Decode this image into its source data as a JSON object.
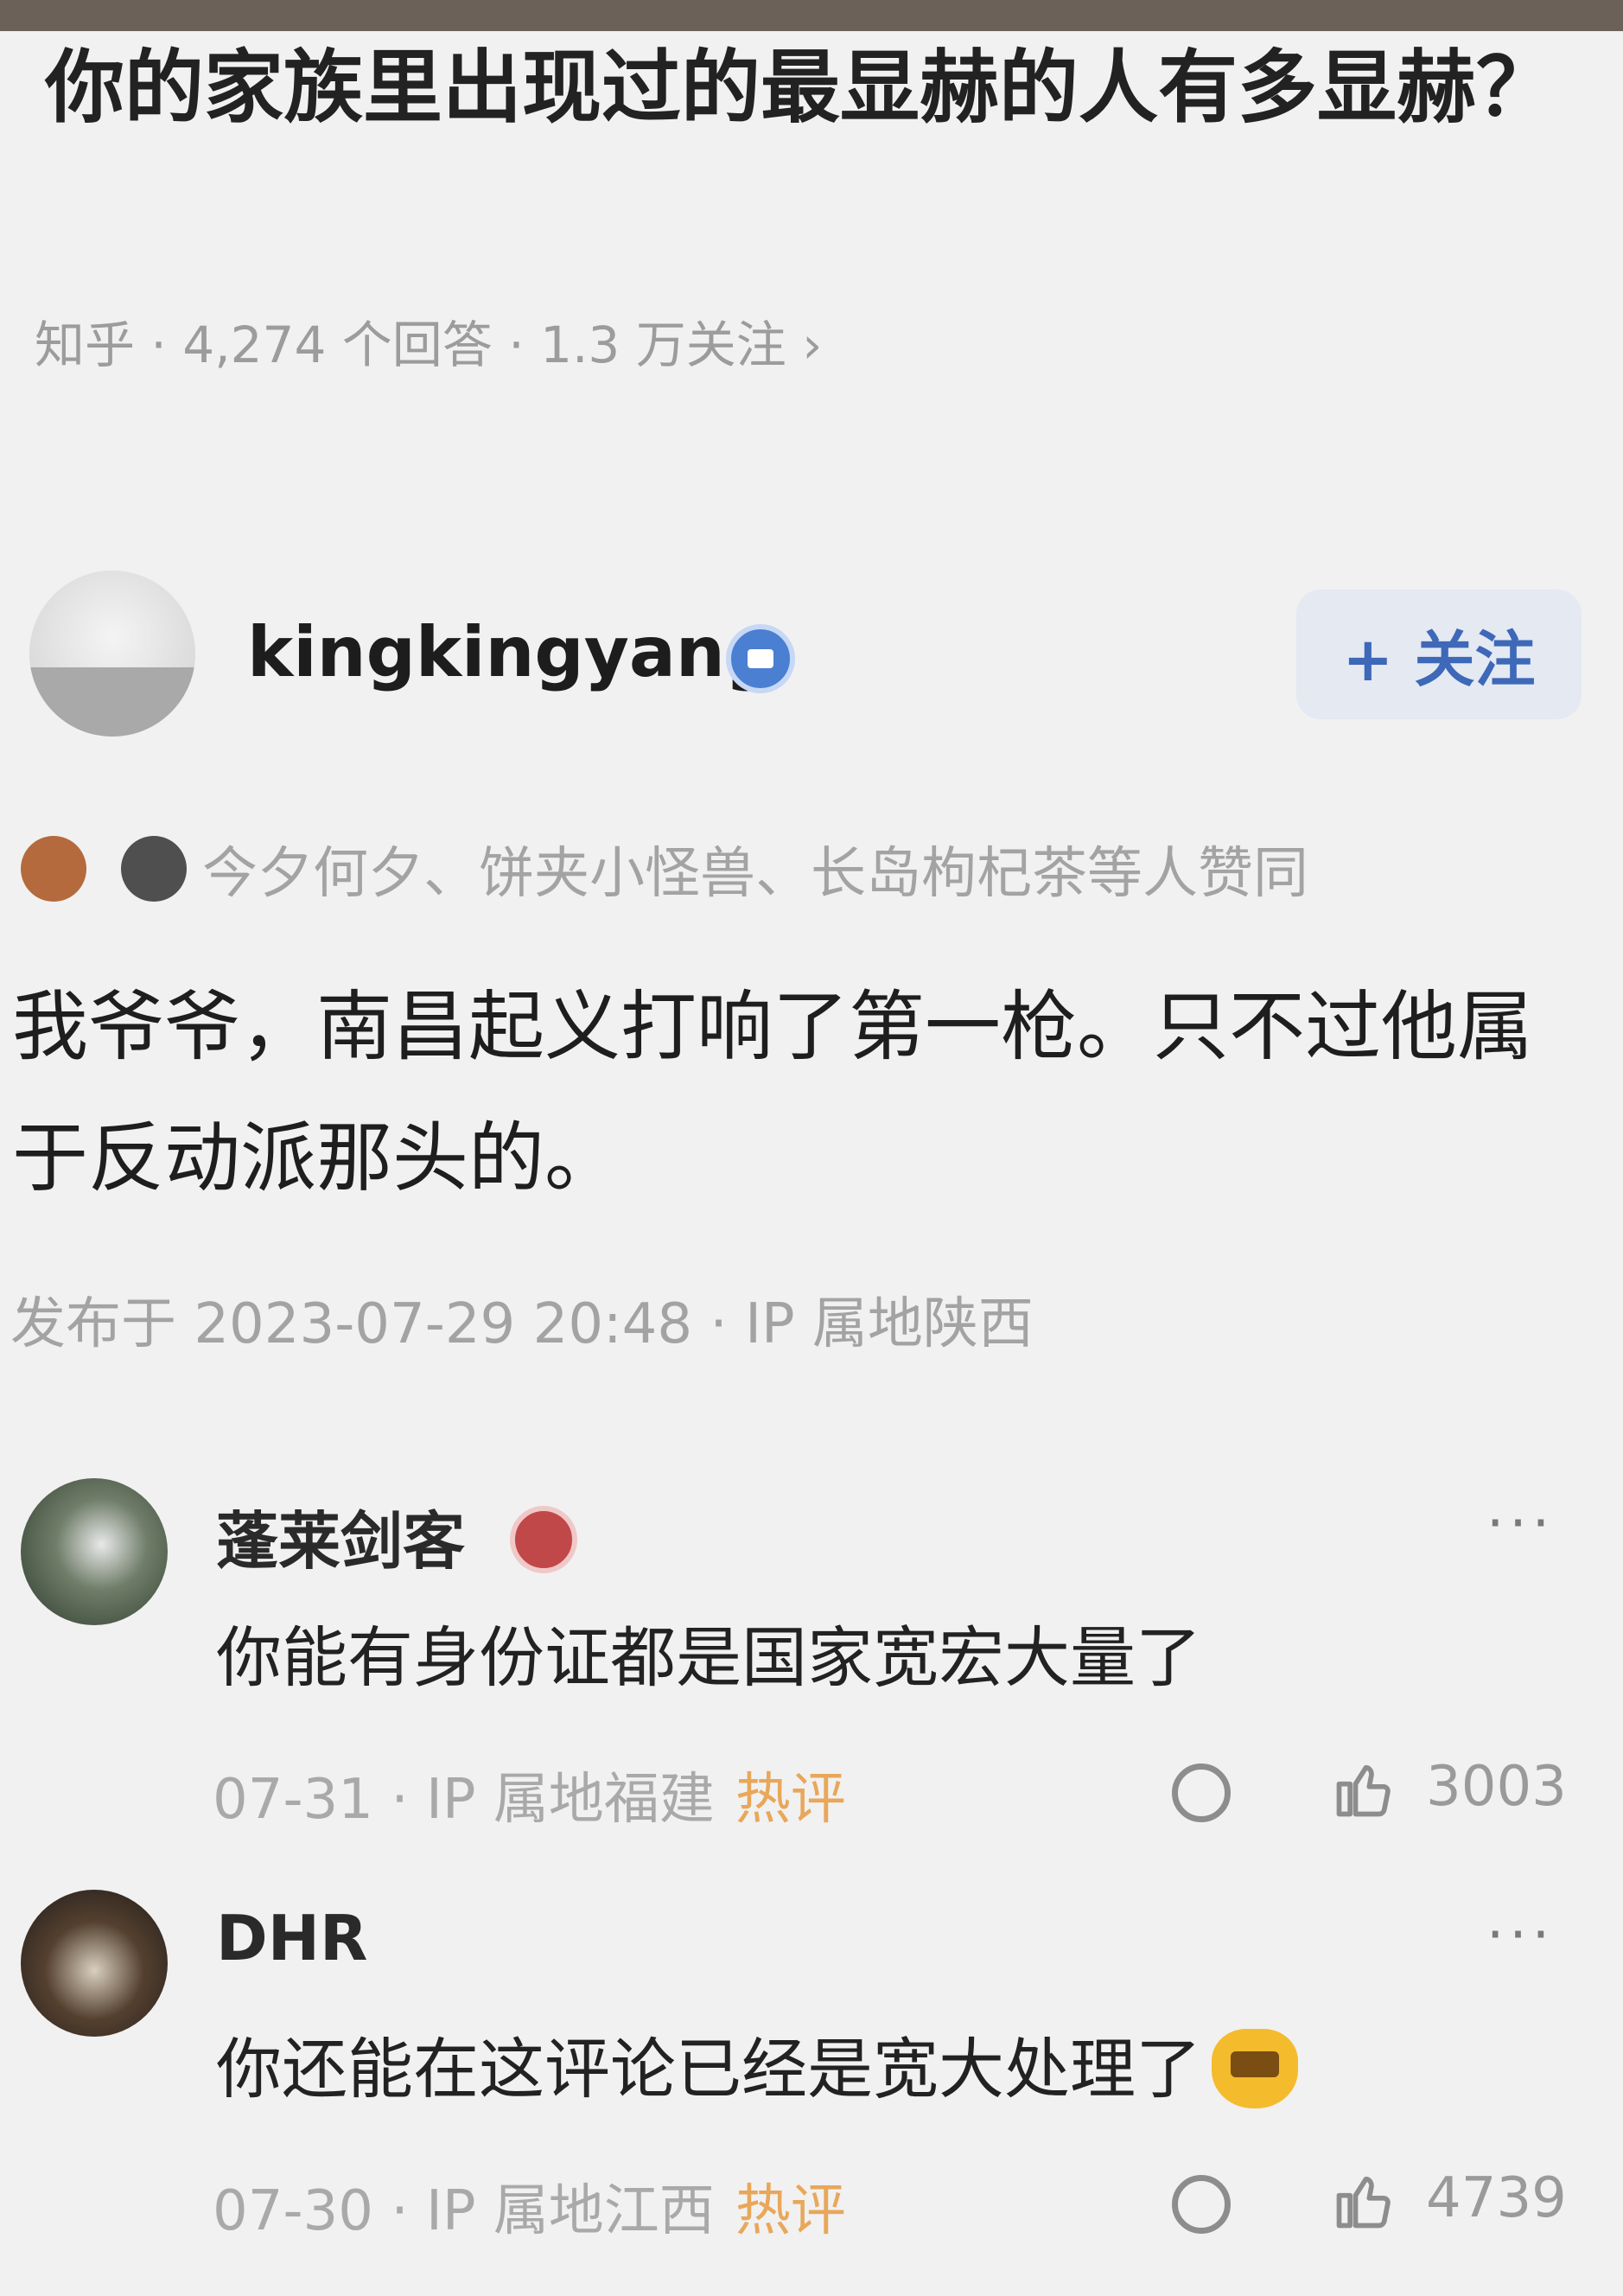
{
  "question": {
    "title": "你的家族里出现过的最显赫的人有多显赫？",
    "meta": "知乎 · 4,274 个回答 · 1.3 万关注 ›"
  },
  "answer": {
    "author": "kingkingyang",
    "follow_label": "+ 关注",
    "upvoters_text": "今夕何夕、饼夹小怪兽、长岛枸杞茶等人赞同",
    "content": "我爷爷，南昌起义打响了第一枪。只不过他属于反动派那头的。",
    "published": "发布于 2023-07-29 20:48 · IP 属地陕西"
  },
  "comments": [
    {
      "name": "蓬莱剑客",
      "text": "你能有身份证都是国家宽宏大量了",
      "meta": "07-31 · IP 属地福建",
      "hot": "热评",
      "likes": "3003"
    },
    {
      "name": "DHR",
      "text": "你还能在这评论已经是宽大处理了",
      "meta": "07-30 · IP 属地江西",
      "hot": "热评",
      "likes": "4739"
    }
  ],
  "more_label": "···",
  "colors": {
    "follow_text": "#3e68b8",
    "hot_label": "#e8a75a",
    "secondary_text": "#a3a3a3",
    "badge_blue": "#4a7fd1"
  }
}
